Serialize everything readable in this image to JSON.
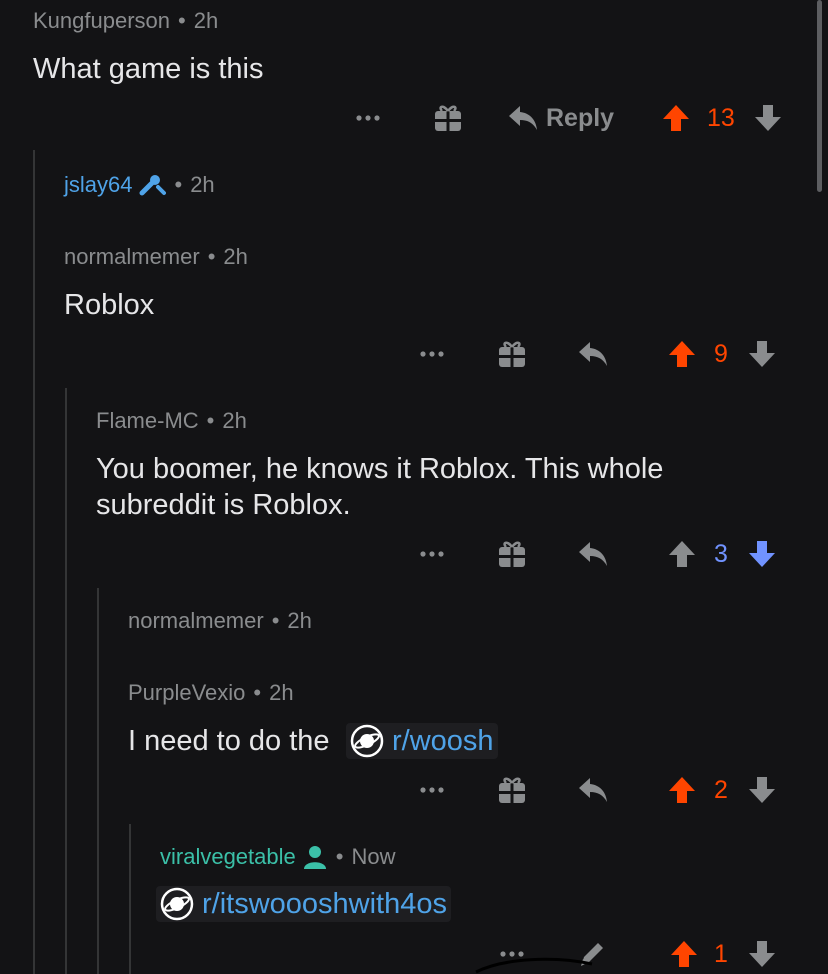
{
  "colors": {
    "background": "#131315",
    "upvote_active": "#ff4500",
    "downvote_active": "#7193ff",
    "link": "#4fa3e8",
    "mod": "#4fa3e8",
    "op": "#3bc0a8",
    "icon": "#8a8c8e"
  },
  "comments": [
    {
      "author": "Kungfuperson",
      "time": "2h",
      "body": "What game is this",
      "actions": {
        "reply_label": "Reply",
        "score": "13",
        "vote": "up"
      }
    },
    {
      "author": "jslay64",
      "time": "2h",
      "badge_icon": "mod-wrench-icon",
      "deleted": true
    },
    {
      "author": "normalmemer",
      "time": "2h",
      "body": "Roblox",
      "actions": {
        "score": "9",
        "vote": "up"
      }
    },
    {
      "author": "Flame-MC",
      "time": "2h",
      "body_line1": "You boomer, he knows it Roblox. This whole",
      "body_line2": "subreddit is Roblox.",
      "actions": {
        "score": "3",
        "vote": "down"
      }
    },
    {
      "author": "normalmemer",
      "time": "2h",
      "deleted": true
    },
    {
      "author": "PurpleVexio",
      "time": "2h",
      "body_prefix": "I need to do the",
      "sublink": "r/woosh",
      "actions": {
        "score": "2",
        "vote": "up"
      }
    },
    {
      "author": "viralvegetable",
      "time": "Now",
      "badge_icon": "op-person-icon",
      "sublink": "r/itswoooshwith4os",
      "actions": {
        "score": "1",
        "vote": "up",
        "edit_icon": "pencil-icon"
      }
    }
  ],
  "separator": "•",
  "more_icon": "more-dots-icon",
  "award_icon": "gift-icon",
  "reply_icon": "reply-arrow-icon"
}
